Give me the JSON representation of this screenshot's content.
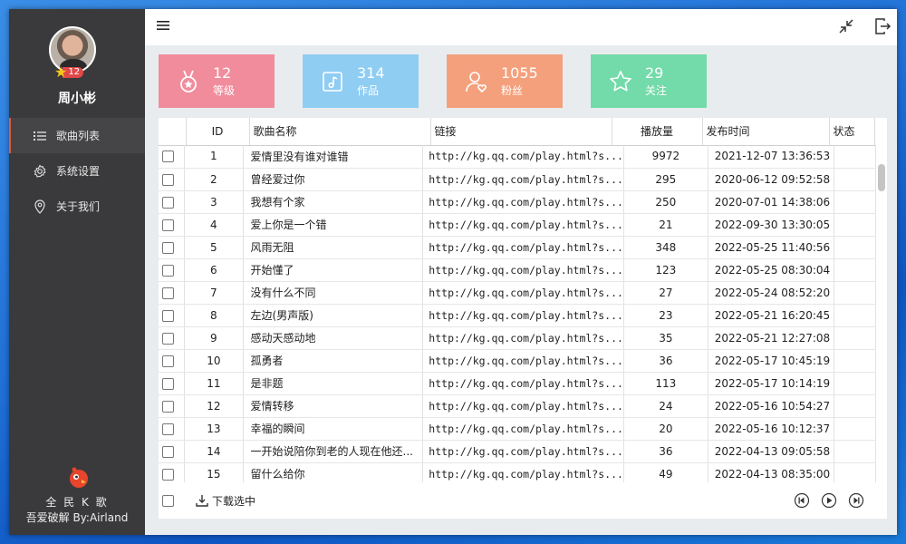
{
  "sidebar": {
    "username": "周小彬",
    "level": "12",
    "nav": [
      {
        "label": "歌曲列表",
        "icon": "list-icon",
        "active": true
      },
      {
        "label": "系统设置",
        "icon": "gear-icon",
        "active": false
      },
      {
        "label": "关于我们",
        "icon": "location-pin-icon",
        "active": false
      }
    ],
    "app_name": "全 民 K 歌",
    "credit": "吾爱破解 By:Airland"
  },
  "stats": [
    {
      "value": "12",
      "label": "等级",
      "icon": "medal-icon",
      "color": "#f18c9c"
    },
    {
      "value": "314",
      "label": "作品",
      "icon": "music-note-icon",
      "color": "#8fcdf3"
    },
    {
      "value": "1055",
      "label": "粉丝",
      "icon": "user-heart-icon",
      "color": "#f4a07d"
    },
    {
      "value": "29",
      "label": "关注",
      "icon": "star-icon",
      "color": "#72dba9"
    }
  ],
  "table": {
    "headers": [
      "ID",
      "歌曲名称",
      "链接",
      "播放量",
      "发布时间",
      "状态"
    ],
    "rows": [
      [
        "1",
        "爱情里没有谁对谁错",
        "http://kg.qq.com/play.html?s...",
        "9972",
        "2021-12-07 13:36:53",
        ""
      ],
      [
        "2",
        "曾经爱过你",
        "http://kg.qq.com/play.html?s...",
        "295",
        "2020-06-12 09:52:58",
        ""
      ],
      [
        "3",
        "我想有个家",
        "http://kg.qq.com/play.html?s...",
        "250",
        "2020-07-01 14:38:06",
        ""
      ],
      [
        "4",
        "爱上你是一个错",
        "http://kg.qq.com/play.html?s...",
        "21",
        "2022-09-30 13:30:05",
        ""
      ],
      [
        "5",
        "风雨无阻",
        "http://kg.qq.com/play.html?s...",
        "348",
        "2022-05-25 11:40:56",
        ""
      ],
      [
        "6",
        "开始懂了",
        "http://kg.qq.com/play.html?s...",
        "123",
        "2022-05-25 08:30:04",
        ""
      ],
      [
        "7",
        "没有什么不同",
        "http://kg.qq.com/play.html?s...",
        "27",
        "2022-05-24 08:52:20",
        ""
      ],
      [
        "8",
        "左边(男声版)",
        "http://kg.qq.com/play.html?s...",
        "23",
        "2022-05-21 16:20:45",
        ""
      ],
      [
        "9",
        "感动天感动地",
        "http://kg.qq.com/play.html?s...",
        "35",
        "2022-05-21 12:27:08",
        ""
      ],
      [
        "10",
        "孤勇者",
        "http://kg.qq.com/play.html?s...",
        "36",
        "2022-05-17 10:45:19",
        ""
      ],
      [
        "11",
        "是非题",
        "http://kg.qq.com/play.html?s...",
        "113",
        "2022-05-17 10:14:19",
        ""
      ],
      [
        "12",
        "爱情转移",
        "http://kg.qq.com/play.html?s...",
        "24",
        "2022-05-16 10:54:27",
        ""
      ],
      [
        "13",
        "幸福的瞬间",
        "http://kg.qq.com/play.html?s...",
        "20",
        "2022-05-16 10:12:37",
        ""
      ],
      [
        "14",
        "一开始说陪你到老的人现在他还...",
        "http://kg.qq.com/play.html?s...",
        "36",
        "2022-04-13 09:05:58",
        ""
      ],
      [
        "15",
        "留什么给你",
        "http://kg.qq.com/play.html?s...",
        "49",
        "2022-04-13 08:35:00",
        ""
      ]
    ]
  },
  "footer": {
    "download_label": "下载选中"
  },
  "colors": {
    "sidebar_bg": "#3a3a3c",
    "accent": "#e05a3a"
  }
}
